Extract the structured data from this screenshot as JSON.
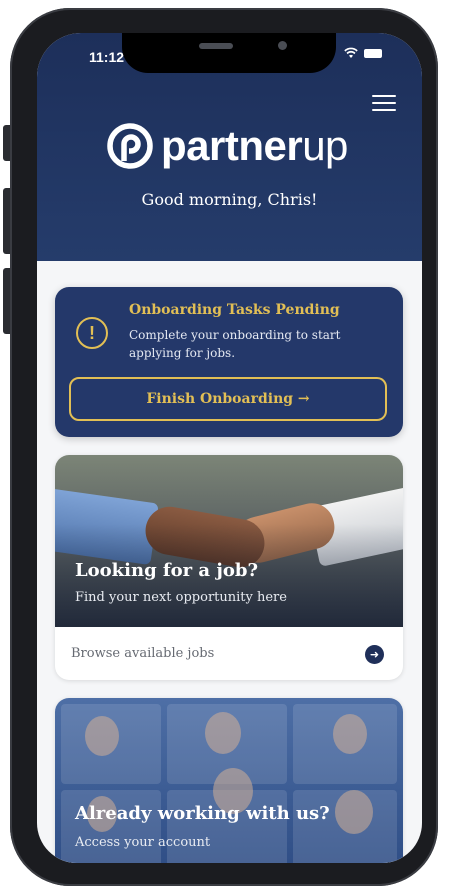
{
  "status_bar": {
    "time": "11:12"
  },
  "brand": {
    "name_bold": "partner",
    "name_light": "up"
  },
  "header": {
    "greeting": "Good morning, Chris!"
  },
  "onboarding": {
    "title": "Onboarding Tasks Pending",
    "description": "Complete your onboarding to start applying for jobs.",
    "button_label": "Finish Onboarding →",
    "icon": "warning-exclamation-icon"
  },
  "job_card": {
    "heading": "Looking for a job?",
    "subheading": "Find your next opportunity here",
    "link_label": "Browse available jobs",
    "link_icon": "arrow-right-circle-icon"
  },
  "account_card": {
    "heading": "Already working with us?",
    "subheading": "Access your account"
  },
  "colors": {
    "navy": "#1f2f59",
    "accent_gold": "#e2bf55",
    "card_bg": "#24386a"
  }
}
